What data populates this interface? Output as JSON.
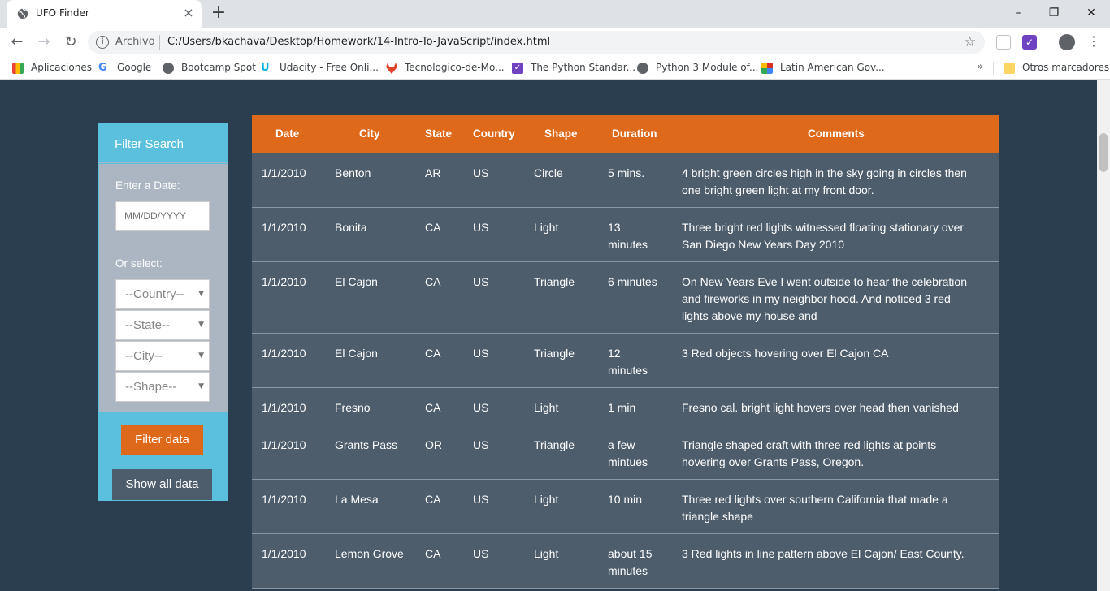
{
  "browser": {
    "tab_title": "UFO Finder",
    "tab_close": "×",
    "new_tab": "+",
    "window_controls": [
      "–",
      "❐",
      "✕"
    ],
    "address_protocol": "Archivo",
    "address_url": "C:/Users/bkachava/Desktop/Homework/14-Intro-To-JavaScript/index.html",
    "bookmarks": [
      {
        "label": "Aplicaciones",
        "icon": "apps-grid-icon",
        "color": "#4285f4"
      },
      {
        "label": "Google",
        "icon": "google-icon",
        "color": "#4285f4"
      },
      {
        "label": "Bootcamp Spot",
        "icon": "globe-icon",
        "color": "#5f6368"
      },
      {
        "label": "Udacity - Free Onli...",
        "icon": "udacity-icon",
        "color": "#02b3e4"
      },
      {
        "label": "Tecnologico-de-Mo...",
        "icon": "gitlab-icon",
        "color": "#e24329"
      },
      {
        "label": "The Python Standar...",
        "icon": "checkbox-icon",
        "color": "#6f42c1"
      },
      {
        "label": "Python 3 Module of...",
        "icon": "globe-icon",
        "color": "#5f6368"
      },
      {
        "label": "Latin American Gov...",
        "icon": "latam-icon",
        "color": "#d93025"
      }
    ],
    "bookmarks_overflow": "»",
    "other_bookmarks": "Otros marcadores"
  },
  "filter": {
    "title": "Filter Search",
    "date_label": "Enter a Date:",
    "date_placeholder": "MM/DD/YYYY",
    "select_label": "Or select:",
    "selects": [
      "--Country--",
      "--State--",
      "--City--",
      "--Shape--"
    ],
    "filter_button": "Filter data",
    "show_all_button": "Show all data"
  },
  "table": {
    "headers": [
      "Date",
      "City",
      "State",
      "Country",
      "Shape",
      "Duration",
      "Comments"
    ],
    "rows": [
      {
        "date": "1/1/2010",
        "city": "Benton",
        "state": "AR",
        "country": "US",
        "shape": "Circle",
        "duration": [
          "5 mins."
        ],
        "comments": [
          "4 bright green circles high in the sky going in circles then",
          "one bright green light at my front door."
        ]
      },
      {
        "date": "1/1/2010",
        "city": "Bonita",
        "state": "CA",
        "country": "US",
        "shape": "Light",
        "duration": [
          "13",
          "minutes"
        ],
        "comments": [
          "Three bright red lights witnessed floating stationary over",
          "San Diego New Years Day 2010"
        ]
      },
      {
        "date": "1/1/2010",
        "city": "El Cajon",
        "state": "CA",
        "country": "US",
        "shape": "Triangle",
        "duration": [
          "6 minutes"
        ],
        "comments": [
          "On New Years Eve I went outside to hear the celebration",
          "and fireworks in my neighbor hood. And noticed 3 red",
          "lights above my house and"
        ]
      },
      {
        "date": "1/1/2010",
        "city": "El Cajon",
        "state": "CA",
        "country": "US",
        "shape": "Triangle",
        "duration": [
          "12",
          "minutes"
        ],
        "comments": [
          "3 Red objects hovering over El Cajon CA"
        ]
      },
      {
        "date": "1/1/2010",
        "city": "Fresno",
        "state": "CA",
        "country": "US",
        "shape": "Light",
        "duration": [
          "1 min"
        ],
        "comments": [
          "Fresno cal. bright light hovers over head then vanished"
        ]
      },
      {
        "date": "1/1/2010",
        "city": "Grants Pass",
        "state": "OR",
        "country": "US",
        "shape": "Triangle",
        "duration": [
          "a few",
          "mintues"
        ],
        "comments": [
          "Triangle shaped craft with three red lights at points",
          "hovering over Grants Pass, Oregon."
        ]
      },
      {
        "date": "1/1/2010",
        "city": "La Mesa",
        "state": "CA",
        "country": "US",
        "shape": "Light",
        "duration": [
          "10 min"
        ],
        "comments": [
          "Three red lights over southern California that made a",
          "triangle shape"
        ]
      },
      {
        "date": "1/1/2010",
        "city": "Lemon Grove",
        "state": "CA",
        "country": "US",
        "shape": "Light",
        "duration": [
          "about 15",
          "minutes"
        ],
        "comments": [
          "3 Red lights in line pattern above El Cajon/ East County."
        ]
      }
    ]
  },
  "colors": {
    "page_bg": "#2b3e50",
    "accent_orange": "#df691a",
    "filter_blue": "#5bc0de",
    "row_bg": "#4e5d6c"
  }
}
